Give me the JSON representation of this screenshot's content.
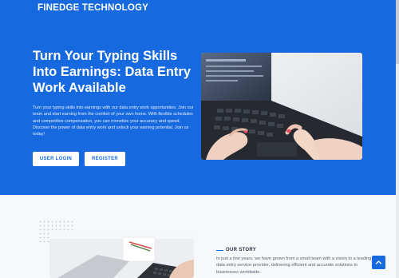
{
  "header": {
    "brand": "FINEDGE TECHNOLOGY"
  },
  "hero": {
    "title": "Turn Your Typing Skills Into Earnings: Data Entry Work Available",
    "description": "Turn your typing skills into earnings with our data entry work opportunities. Join our team and start earning from the comfort of your own home. With flexible schedules and competitive compensation, you can monetize your accuracy and speed. Discover the power of data entry work and unlock your earning potential. Join us today!",
    "login_label": "USER LOGIN",
    "register_label": "REGISTER"
  },
  "story": {
    "label": "OUR STORY",
    "text": "In just a few years, we have grown from a small team with a vision to a leading data entry service provider, delivering efficient and accurate solutions to businesses worldwide."
  },
  "icons": {
    "back_to_top": "chevron-up-icon"
  },
  "colors": {
    "primary": "#1769e0",
    "background": "#ffffff",
    "section": "#f7f8fa"
  }
}
